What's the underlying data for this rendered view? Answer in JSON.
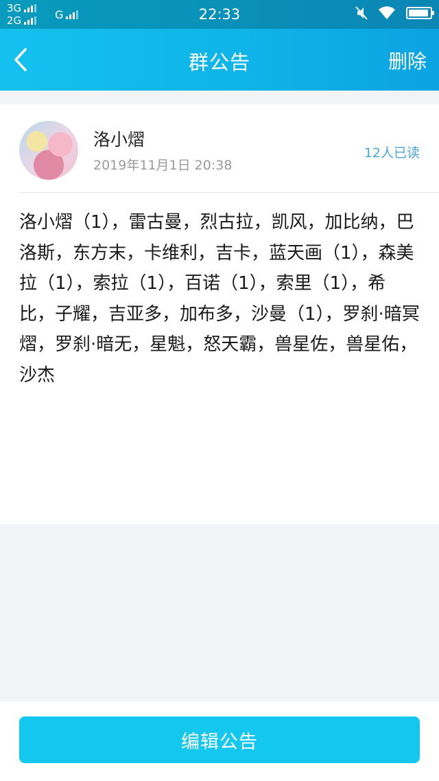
{
  "status_bar": {
    "network_top": "3G",
    "network_bottom": "2G",
    "network_second": "G",
    "time": "22:33",
    "icons": [
      "signal-bars-icon",
      "mute-icon",
      "wifi-icon",
      "battery-icon"
    ],
    "battery_level": 0.92
  },
  "header": {
    "back_icon": "chevron-left-icon",
    "title": "群公告",
    "action_label": "删除"
  },
  "announcement": {
    "author": "洛小熠",
    "date": "2019年11月1日 20:38",
    "read_count": "12人已读",
    "content": "洛小熠（1），雷古曼，烈古拉，凯风，加比纳，巴洛斯，东方末，卡维利，吉卡，蓝天画（1），森美拉（1），索拉（1），百诺（1），索里（1），希比，子耀，吉亚多，加布多，沙曼（1），罗刹·暗冥熠，罗刹·暗无，星魁，怒天霸，兽星佐，兽星佑，沙杰"
  },
  "footer": {
    "edit_label": "编辑公告"
  },
  "colors": {
    "status_bar": "#0b8fb8",
    "nav_bar": "#12b8eb",
    "button": "#14c7ee",
    "read_count": "#4aa6d9",
    "background": "#f2f3f5"
  }
}
